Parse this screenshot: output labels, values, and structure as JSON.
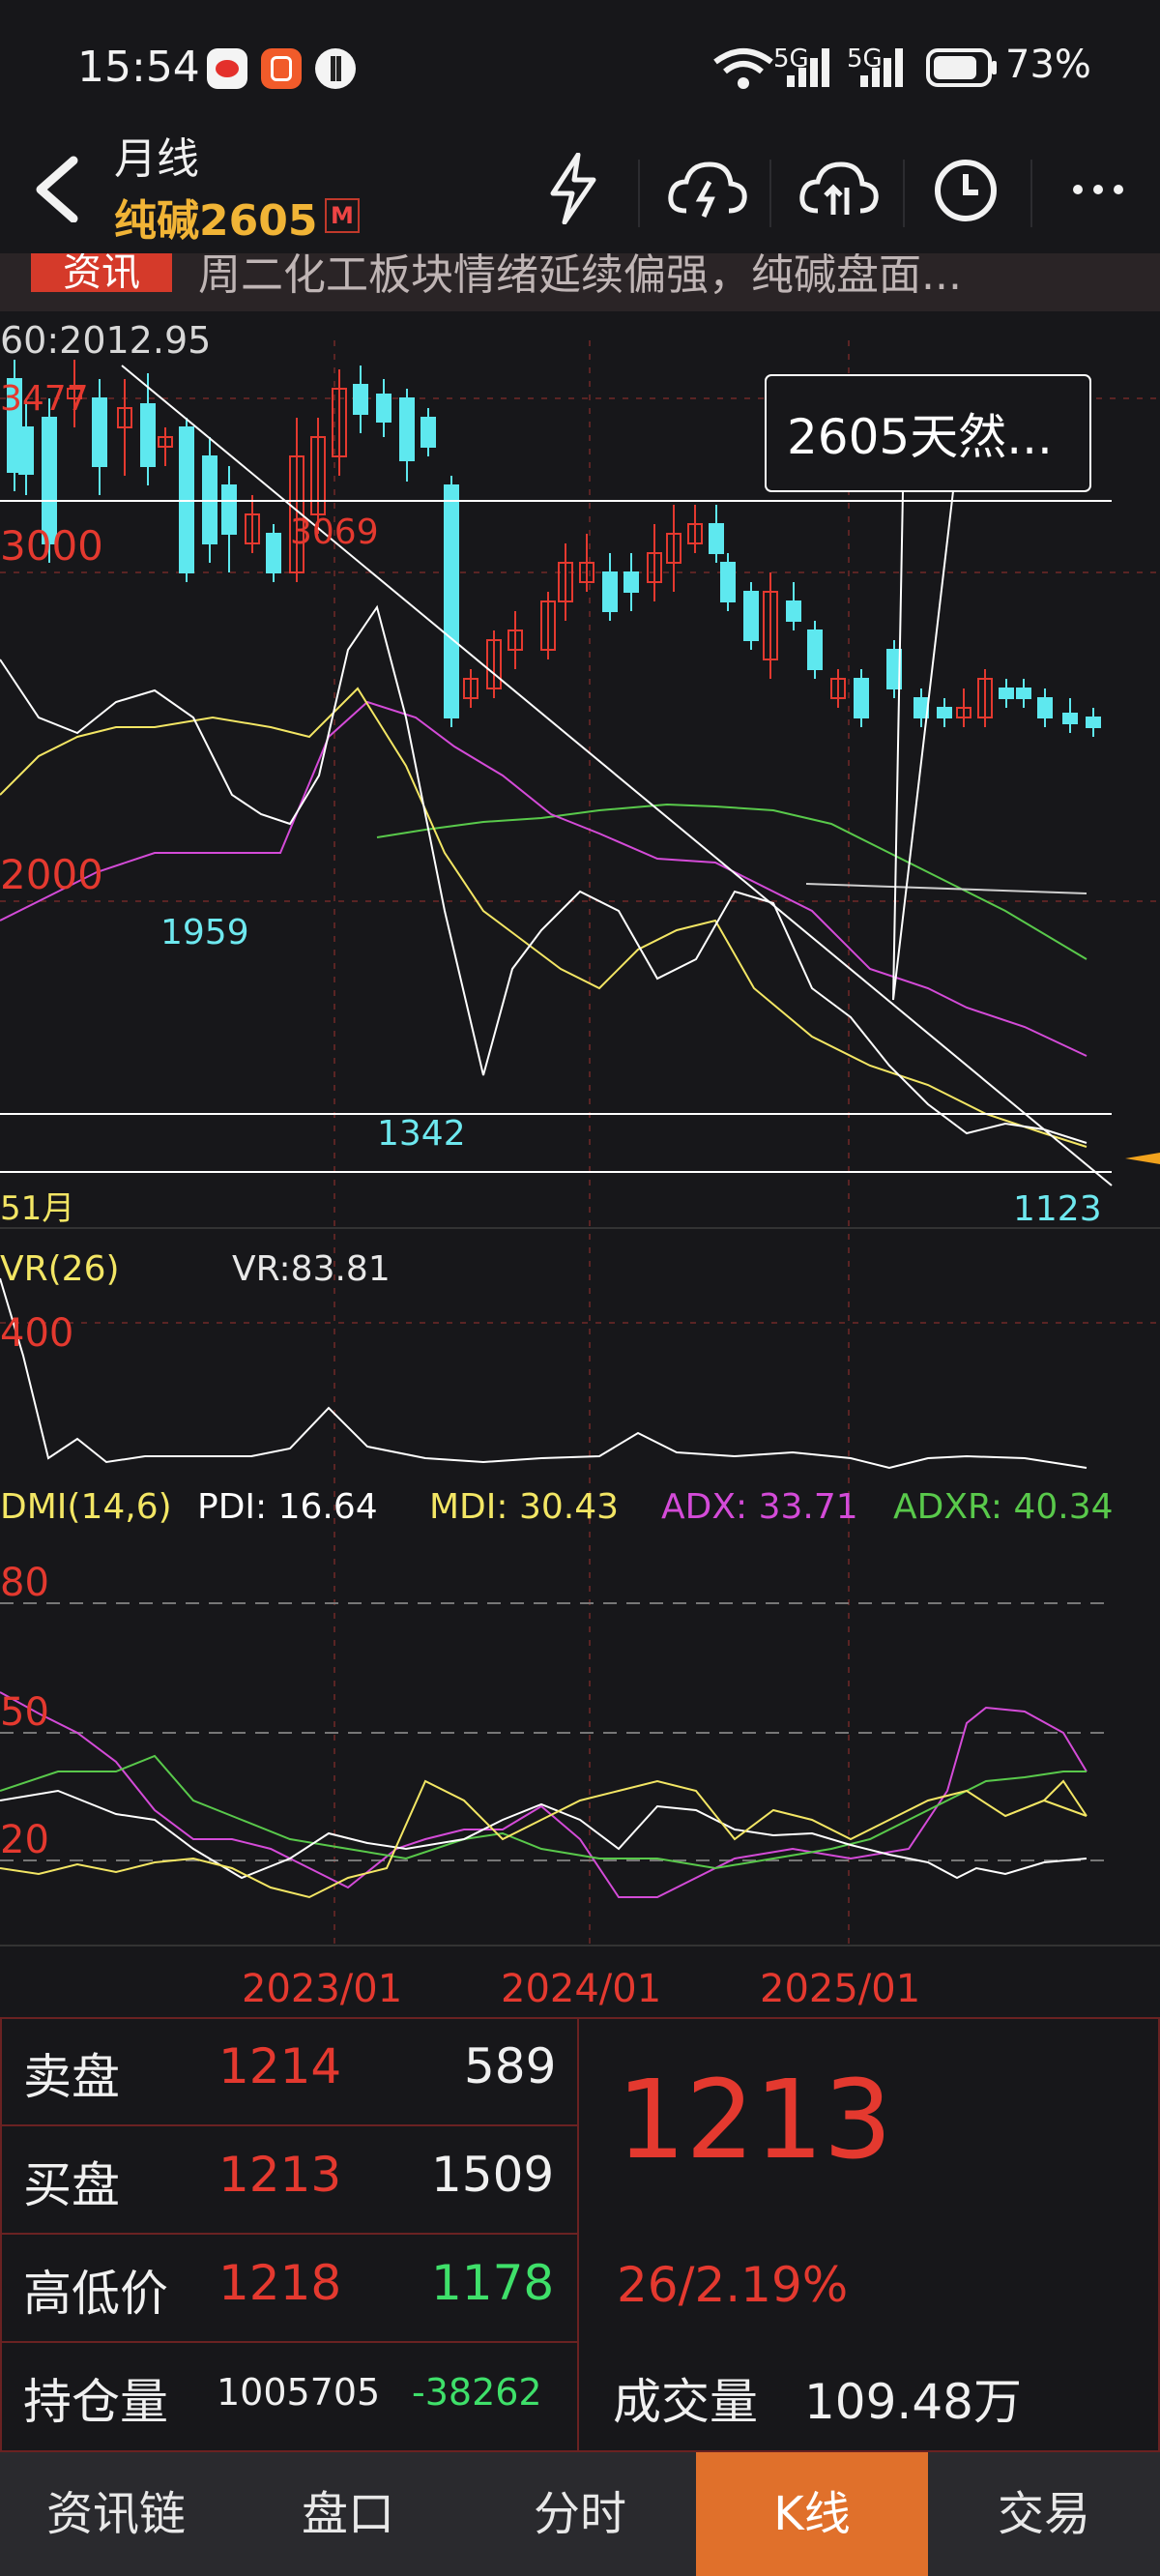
{
  "status_bar": {
    "time": "15:54",
    "battery": "73%",
    "network_1": "5G",
    "network_2": "5G"
  },
  "header": {
    "period": "月线",
    "symbol": "纯碱2605",
    "badge": "M"
  },
  "news": {
    "tag": "资讯",
    "text": "周二化工板块情绪延续偏强，纯碱盘面..."
  },
  "main_chart": {
    "ma_label": "60:2012.95",
    "high_label": "3477",
    "price_ticks": [
      "3000",
      "2000"
    ],
    "peak_label": "3069",
    "low_labels": [
      "1959",
      "1342",
      "1123"
    ],
    "period_count": "51月",
    "annotation": "2605天然...",
    "colors": {
      "up": "#e4392f",
      "down": "#5ee8ef",
      "ma5": "#ffffff",
      "ma10": "#f3e664",
      "ma20": "#d44bd8",
      "ma60": "#59c94b"
    }
  },
  "vr_panel": {
    "title": "VR(26)",
    "value": "VR:83.81",
    "tick": "400"
  },
  "dmi_panel": {
    "title": "DMI(14,6)",
    "pdi": "PDI: 16.64",
    "mdi": "MDI: 30.43",
    "adx": "ADX: 33.71",
    "adxr": "ADXR: 40.34",
    "ticks": [
      "80",
      "50",
      "20"
    ]
  },
  "time_axis": [
    "2023/01",
    "2024/01",
    "2025/01"
  ],
  "order_panel": {
    "sell_label": "卖盘",
    "sell_price": "1214",
    "sell_volume": "589",
    "buy_label": "买盘",
    "buy_price": "1213",
    "buy_volume": "1509",
    "hl_label": "高低价",
    "high": "1218",
    "low": "1178",
    "oi_label": "持仓量",
    "oi": "1005705",
    "oi_change": "-38262",
    "last_price": "1213",
    "change": "26/2.19%",
    "volume_label": "成交量",
    "volume": "109.48万"
  },
  "bottom_nav": [
    "资讯链",
    "盘口",
    "分时",
    "K线",
    "交易"
  ]
}
